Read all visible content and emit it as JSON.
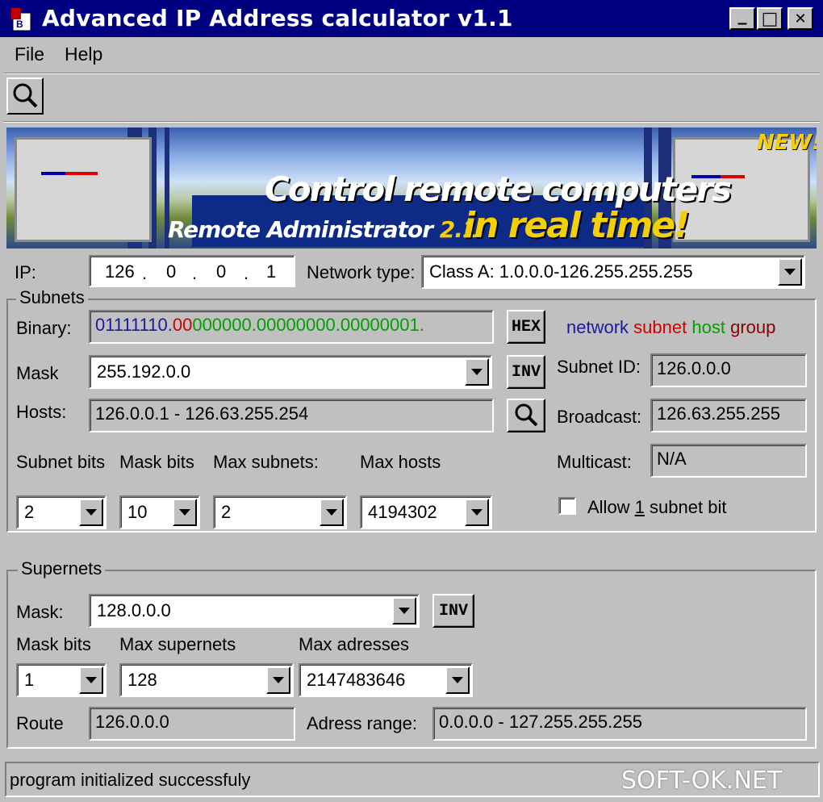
{
  "window": {
    "title": "Advanced IP Address calculator v1.1",
    "controls": {
      "minimize": "_",
      "maximize": "□",
      "close": "✕"
    }
  },
  "menu": {
    "file": "File",
    "help": "Help"
  },
  "banner": {
    "line1": "Control remote computers",
    "product": "Remote Administrator",
    "version": "2.1",
    "line2": "in real time!",
    "badge": "NEW!"
  },
  "ip": {
    "label": "IP:",
    "octets": [
      "126",
      "0",
      "0",
      "1"
    ],
    "dot": "."
  },
  "network_type": {
    "label": "Network type:",
    "value": "Class A:   1.0.0.0-126.255.255.255"
  },
  "subnets": {
    "title": "Subnets",
    "binary_label": "Binary:",
    "binary": {
      "network": "01111110",
      "dot": ".",
      "subnet": "00",
      "host": "000000.00000000.00000001."
    },
    "hex_button": "HEX",
    "legend": {
      "network": "network",
      "subnet": "subnet",
      "host": "host",
      "group": "group"
    },
    "colors": {
      "network": "#1a1aa0",
      "subnet": "#d00000",
      "host": "#00a000",
      "group": "#8a0000"
    },
    "mask_label": "Mask",
    "mask_value": "255.192.0.0",
    "inv_button": "INV",
    "subnet_id_label": "Subnet ID:",
    "subnet_id": "126.0.0.0",
    "hosts_label": "Hosts:",
    "hosts_value": "126.0.0.1 - 126.63.255.254",
    "broadcast_label": "Broadcast:",
    "broadcast": "126.63.255.255",
    "subnet_bits_label": "Subnet bits",
    "mask_bits_label": "Mask bits",
    "max_subnets_label": "Max subnets:",
    "max_hosts_label": "Max hosts",
    "multicast_label": "Multicast:",
    "multicast": "N/A",
    "subnet_bits": "2",
    "mask_bits": "10",
    "max_subnets": "2",
    "max_hosts": "4194302",
    "allow_label_pre": "Allow ",
    "allow_label_u": "1",
    "allow_label_post": " subnet bit"
  },
  "supernets": {
    "title": "Supernets",
    "mask_label": "Mask:",
    "mask_value": "128.0.0.0",
    "inv_button": "INV",
    "mask_bits_label": "Mask bits",
    "max_supernets_label": "Max supernets",
    "max_addresses_label": "Max adresses",
    "mask_bits": "1",
    "max_supernets": "128",
    "max_addresses": "2147483646",
    "route_label": "Route",
    "route": "126.0.0.0",
    "range_label": "Adress range:",
    "range": "0.0.0.0 - 127.255.255.255"
  },
  "status": "program initialized successfuly",
  "watermark": "SOFT-OK.NET"
}
